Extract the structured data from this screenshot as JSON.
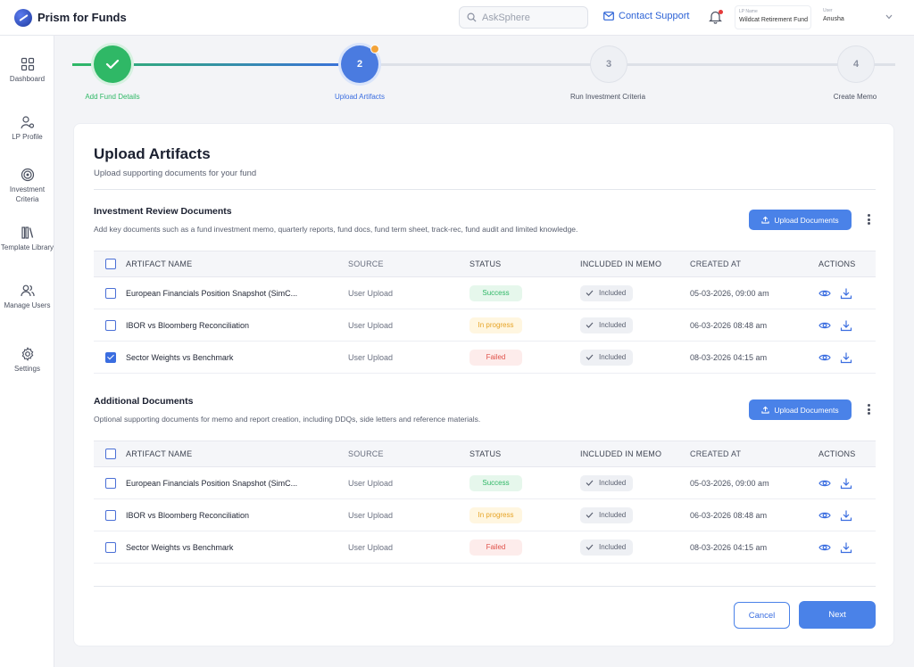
{
  "app": {
    "name": "Prism for Funds"
  },
  "header": {
    "search_placeholder": "AskSphere",
    "contact_label": "Contact Support",
    "lp_key": "LP Name",
    "lp_value": "Wildcat Retirement Fund",
    "user_key": "User",
    "user_value": "Anusha"
  },
  "sidebar": {
    "items": [
      {
        "label": "Dashboard",
        "icon": "grid-icon"
      },
      {
        "label": "LP Profile",
        "icon": "user-gear-icon"
      },
      {
        "label": "Investment Criteria",
        "icon": "target-icon"
      },
      {
        "label": "Template Library",
        "icon": "books-icon"
      },
      {
        "label": "Manage Users",
        "icon": "users-icon"
      },
      {
        "label": "Settings",
        "icon": "gear-icon"
      }
    ]
  },
  "stepper": {
    "steps": [
      {
        "number": "",
        "label": "Add Fund Details",
        "state": "done"
      },
      {
        "number": "2",
        "label": "Upload Artifacts",
        "state": "active"
      },
      {
        "number": "3",
        "label": "Run Investment Criteria",
        "state": "pending"
      },
      {
        "number": "4",
        "label": "Create Memo",
        "state": "pending"
      }
    ]
  },
  "page": {
    "title": "Upload Artifacts",
    "subtitle": "Upload supporting documents for your fund"
  },
  "columns": [
    "ARTIFACT NAME",
    "SOURCE",
    "STATUS",
    "INCLUDED IN MEMO",
    "CREATED AT",
    "ACTIONS"
  ],
  "sections": [
    {
      "title": "Investment Review Documents",
      "description": "Add key documents such as a fund investment memo, quarterly reports, fund docs, fund term sheet, track-rec, fund audit and limited knowledge.",
      "upload_label": "Upload Documents",
      "rows": [
        {
          "checked": false,
          "name": "European Financials Position Snapshot (SimC...",
          "source": "User Upload",
          "status": "Success",
          "status_kind": "success",
          "memo": "Included",
          "created": "05-03-2026, 09:00 am"
        },
        {
          "checked": false,
          "name": "IBOR vs Bloomberg Reconciliation",
          "source": "User Upload",
          "status": "In progress",
          "status_kind": "progress",
          "memo": "Included",
          "created": "06-03-2026 08:48 am"
        },
        {
          "checked": true,
          "name": "Sector Weights vs Benchmark",
          "source": "User Upload",
          "status": "Failed",
          "status_kind": "failed",
          "memo": "Included",
          "created": "08-03-2026 04:15 am"
        }
      ]
    },
    {
      "title": "Additional Documents",
      "description": "Optional supporting documents for memo and report creation, including DDQs, side letters and reference materials.",
      "upload_label": "Upload Documents",
      "rows": [
        {
          "checked": false,
          "name": "European Financials Position Snapshot (SimC...",
          "source": "User Upload",
          "status": "Success",
          "status_kind": "success",
          "memo": "Included",
          "created": "05-03-2026, 09:00 am"
        },
        {
          "checked": false,
          "name": "IBOR vs Bloomberg Reconciliation",
          "source": "User Upload",
          "status": "In progress",
          "status_kind": "progress",
          "memo": "Included",
          "created": "06-03-2026 08:48 am"
        },
        {
          "checked": false,
          "name": "Sector Weights vs Benchmark",
          "source": "User Upload",
          "status": "Failed",
          "status_kind": "failed",
          "memo": "Included",
          "created": "08-03-2026 04:15 am"
        }
      ]
    }
  ],
  "footer": {
    "cancel_label": "Cancel",
    "next_label": "Next"
  },
  "colors": {
    "accent": "#4a82e8",
    "success": "#2fb866",
    "warning": "#e6a325",
    "danger": "#e0524a"
  }
}
